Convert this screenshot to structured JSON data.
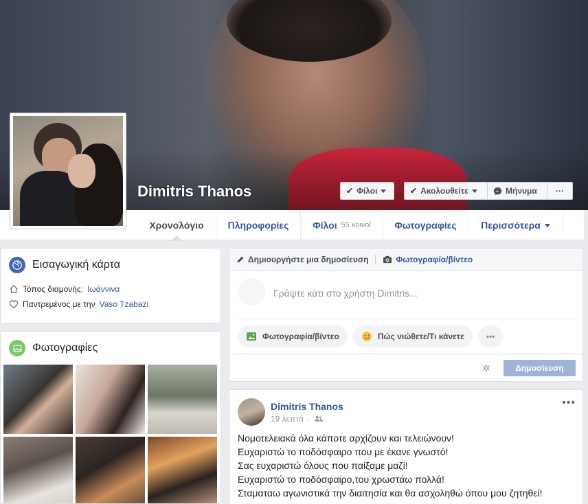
{
  "profile": {
    "name": "Dimitris Thanos"
  },
  "cover_actions": {
    "friends_label": "Φίλοι",
    "follow_label": "Ακολουθείτε",
    "message_label": "Μήνυμα",
    "more_label": "···"
  },
  "nav": {
    "tabs": [
      {
        "label": "Χρονολόγιο"
      },
      {
        "label": "Πληροφορίες"
      },
      {
        "label": "Φίλοι",
        "count": "55 κοινοί"
      },
      {
        "label": "Φωτογραφίες"
      },
      {
        "label": "Περισσότερα"
      }
    ]
  },
  "intro": {
    "title": "Εισαγωγική κάρτα",
    "lives_prefix": "Τόπος διαμονής:",
    "lives_value": "Ιωάννινα",
    "married_prefix": "Παντρεμένος με την",
    "married_value": "Vaso Tzabazi"
  },
  "photos": {
    "title": "Φωτογραφίες"
  },
  "composer": {
    "create_post_label": "Δημιουργήστε μια δημοσίευση",
    "photo_video_label": "Φωτογραφία/βίντεο",
    "placeholder": "Γράψτε κάτι στο χρήστη Dimitris...",
    "pill_photo": "Φωτογραφία/βίντεο",
    "pill_feeling": "Πώς νιώθετε/Τι κάνετε",
    "pill_more": "•••",
    "publish_label": "Δημοσίευση"
  },
  "post": {
    "author": "Dimitris Thanos",
    "time": "19 λεπτά",
    "more": "•••",
    "lines": [
      "Νομοτελειακά όλα κάποτε αρχίζουν και τελειώνουν!",
      "Ευχαριστώ το ποδόσφαιρο που με έκανε γνωστό!",
      "Σας ευχαριστώ όλους που παίξαμε μαζί!",
      "Ευχαριστώ το ποδόσφαιρο,του χρωστάω πολλά!",
      "Σταματαω αγωνιστικά την διαιτησία και θα ασχοληθώ όπου μου ζητηθεί!"
    ]
  },
  "colors": {
    "link": "#365899",
    "background": "#e9ebee",
    "publish_disabled": "#9cb4d8"
  }
}
